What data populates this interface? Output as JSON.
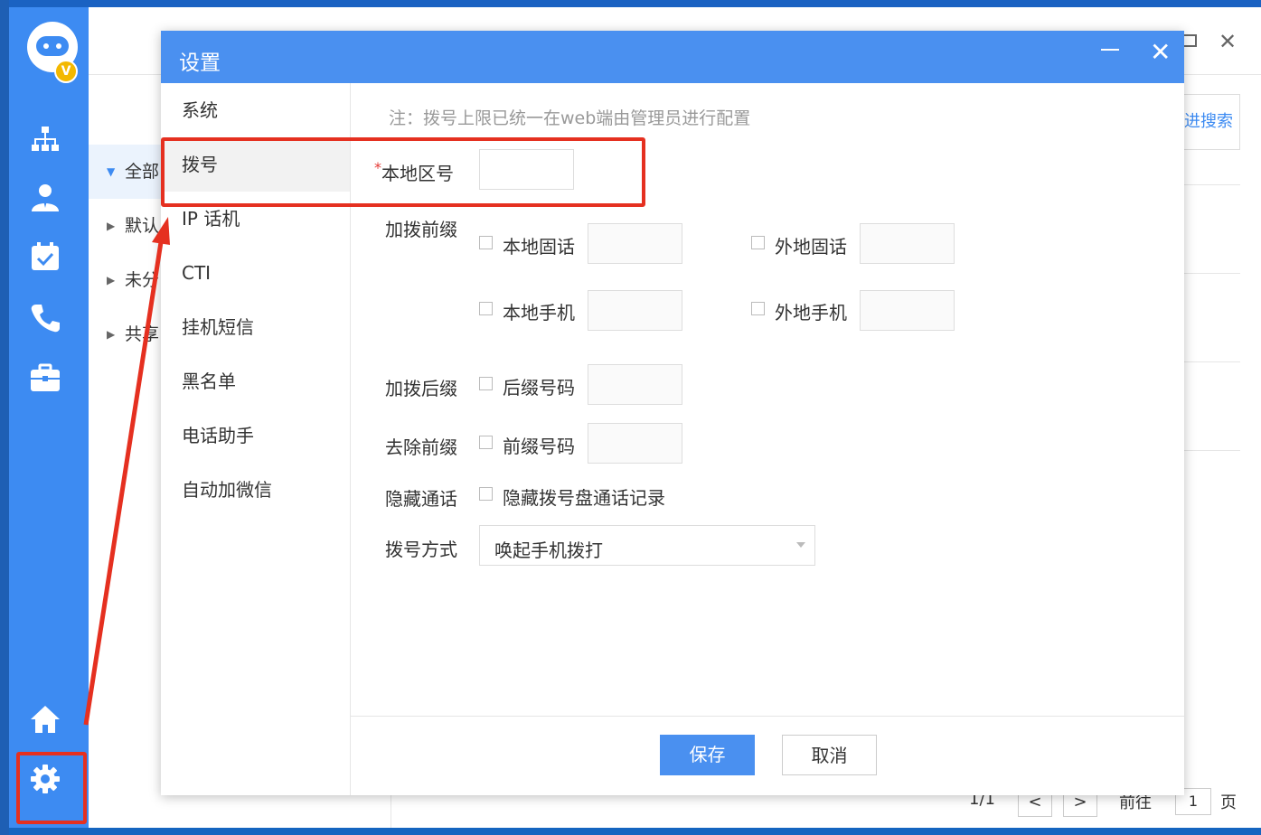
{
  "modal": {
    "title": "设置",
    "menu": [
      "系统",
      "拨号",
      "IP 话机",
      "CTI",
      "挂机短信",
      "黑名单",
      "电话助手",
      "自动加微信"
    ],
    "note": "注：拨号上限已统一在web端由管理员进行配置",
    "local_area_label": "本地区号",
    "add_prefix_label": "加拨前缀",
    "local_landline": "本地固话",
    "remote_landline": "外地固话",
    "local_mobile": "本地手机",
    "remote_mobile": "外地手机",
    "add_suffix_label": "加拨后缀",
    "suffix_number": "后缀号码",
    "remove_prefix_label": "去除前缀",
    "prefix_number": "前缀号码",
    "hide_call_label": "隐藏通话",
    "hide_call_option": "隐藏拨号盘通话记录",
    "dial_mode_label": "拨号方式",
    "dial_mode_value": "唤起手机拨打",
    "save": "保存",
    "cancel": "取消"
  },
  "background": {
    "tree": [
      "全部",
      "默认",
      "未分",
      "共享"
    ],
    "search_link": "进搜索",
    "page_info": "1/1",
    "prev": "<",
    "next": ">",
    "goto_label": "前往",
    "page_value": "1",
    "page_suffix": "页"
  },
  "colors": {
    "accent": "#4a90f0",
    "sidebar": "#3d8bf2",
    "annotation": "#e53020"
  },
  "icons": [
    "org-chart-icon",
    "user-icon",
    "calendar-icon",
    "phone-icon",
    "briefcase-icon",
    "home-icon",
    "gear-icon"
  ]
}
